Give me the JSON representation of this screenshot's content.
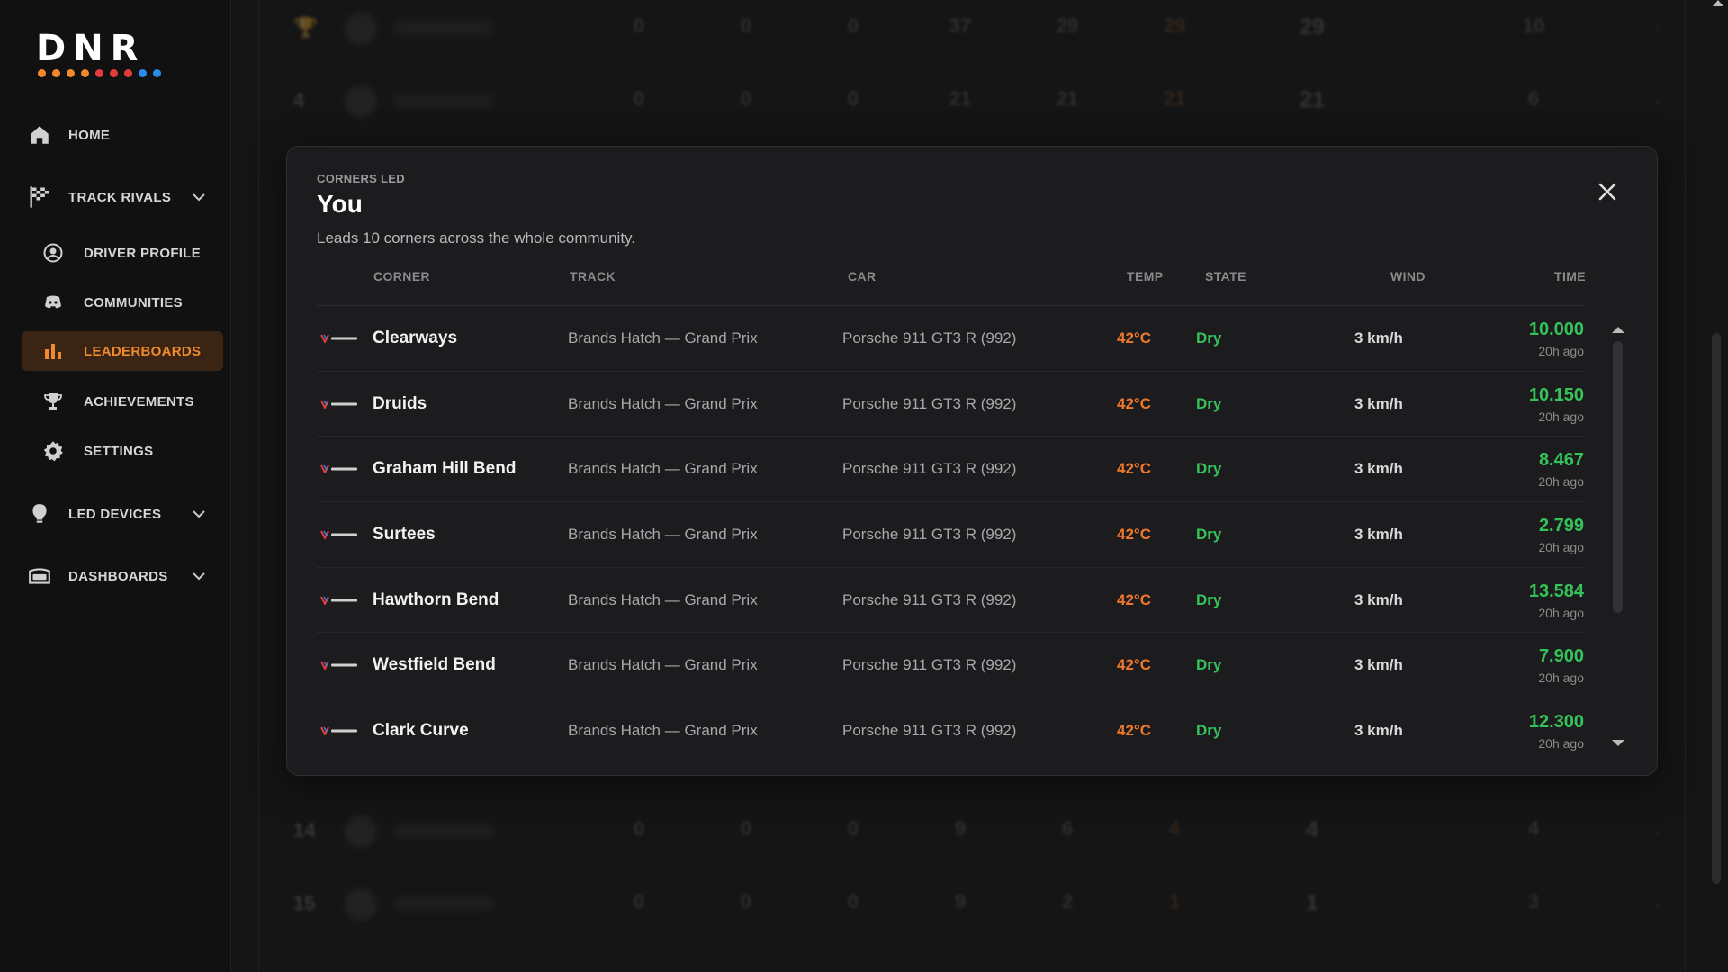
{
  "sidebar": {
    "logo_text": "DNR",
    "logo_dot_colors": [
      "#f08a2c",
      "#f08a2c",
      "#f08a2c",
      "#f08a2c",
      "#e23b3b",
      "#e23b3b",
      "#e23b3b",
      "#2b8be8",
      "#2b8be8"
    ],
    "items": [
      {
        "label": "HOME",
        "icon": "home-icon"
      },
      {
        "label": "TRACK RIVALS",
        "icon": "checkered-flag-icon"
      },
      {
        "label": "DRIVER PROFILE",
        "icon": "user-circle-icon"
      },
      {
        "label": "COMMUNITIES",
        "icon": "discord-icon"
      },
      {
        "label": "LEADERBOARDS",
        "icon": "bar-chart-icon",
        "active": true
      },
      {
        "label": "ACHIEVEMENTS",
        "icon": "trophy-icon"
      },
      {
        "label": "SETTINGS",
        "icon": "gear-icon"
      },
      {
        "label": "LED DEVICES",
        "icon": "lightbulb-icon"
      },
      {
        "label": "DASHBOARDS",
        "icon": "dashboard-icon"
      }
    ]
  },
  "background_table": {
    "rows": [
      {
        "rank": "",
        "icon": "trophy-icon",
        "values": [
          "0",
          "0",
          "0",
          "37",
          "29",
          "29",
          "29",
          "10"
        ]
      },
      {
        "rank": "4",
        "values": [
          "0",
          "0",
          "0",
          "21",
          "21",
          "21",
          "21",
          "6"
        ]
      },
      {
        "rank": "14",
        "values": [
          "0",
          "0",
          "0",
          "9",
          "6",
          "4",
          "4",
          "4"
        ]
      },
      {
        "rank": "15",
        "values": [
          "0",
          "0",
          "0",
          "9",
          "2",
          "1",
          "1",
          "3"
        ]
      }
    ]
  },
  "modal": {
    "label": "CORNERS LED",
    "title": "You",
    "description": "Leads 10 corners across the whole community.",
    "columns": {
      "corner": "CORNER",
      "track": "TRACK",
      "car": "CAR",
      "temp": "TEMP",
      "state": "STATE",
      "wind": "WIND",
      "time": "TIME"
    },
    "rows": [
      {
        "corner": "Clearways",
        "track": "Brands Hatch — Grand Prix",
        "car": "Porsche 911 GT3 R (992)",
        "temp": "42°C",
        "state": "Dry",
        "wind": "3 km/h",
        "time": "10.000",
        "ago": "20h ago"
      },
      {
        "corner": "Druids",
        "track": "Brands Hatch — Grand Prix",
        "car": "Porsche 911 GT3 R (992)",
        "temp": "42°C",
        "state": "Dry",
        "wind": "3 km/h",
        "time": "10.150",
        "ago": "20h ago"
      },
      {
        "corner": "Graham Hill Bend",
        "track": "Brands Hatch — Grand Prix",
        "car": "Porsche 911 GT3 R (992)",
        "temp": "42°C",
        "state": "Dry",
        "wind": "3 km/h",
        "time": "8.467",
        "ago": "20h ago"
      },
      {
        "corner": "Surtees",
        "track": "Brands Hatch — Grand Prix",
        "car": "Porsche 911 GT3 R (992)",
        "temp": "42°C",
        "state": "Dry",
        "wind": "3 km/h",
        "time": "2.799",
        "ago": "20h ago"
      },
      {
        "corner": "Hawthorn Bend",
        "track": "Brands Hatch — Grand Prix",
        "car": "Porsche 911 GT3 R (992)",
        "temp": "42°C",
        "state": "Dry",
        "wind": "3 km/h",
        "time": "13.584",
        "ago": "20h ago"
      },
      {
        "corner": "Westfield Bend",
        "track": "Brands Hatch — Grand Prix",
        "car": "Porsche 911 GT3 R (992)",
        "temp": "42°C",
        "state": "Dry",
        "wind": "3 km/h",
        "time": "7.900",
        "ago": "20h ago"
      },
      {
        "corner": "Clark Curve",
        "track": "Brands Hatch — Grand Prix",
        "car": "Porsche 911 GT3 R (992)",
        "temp": "42°C",
        "state": "Dry",
        "wind": "3 km/h",
        "time": "12.300",
        "ago": "20h ago"
      }
    ]
  },
  "colors": {
    "accent": "#f08a2c",
    "time_green": "#35c25a",
    "temp_orange": "#f0782a",
    "background": "#151516",
    "modal_bg": "#1c1c1e"
  }
}
